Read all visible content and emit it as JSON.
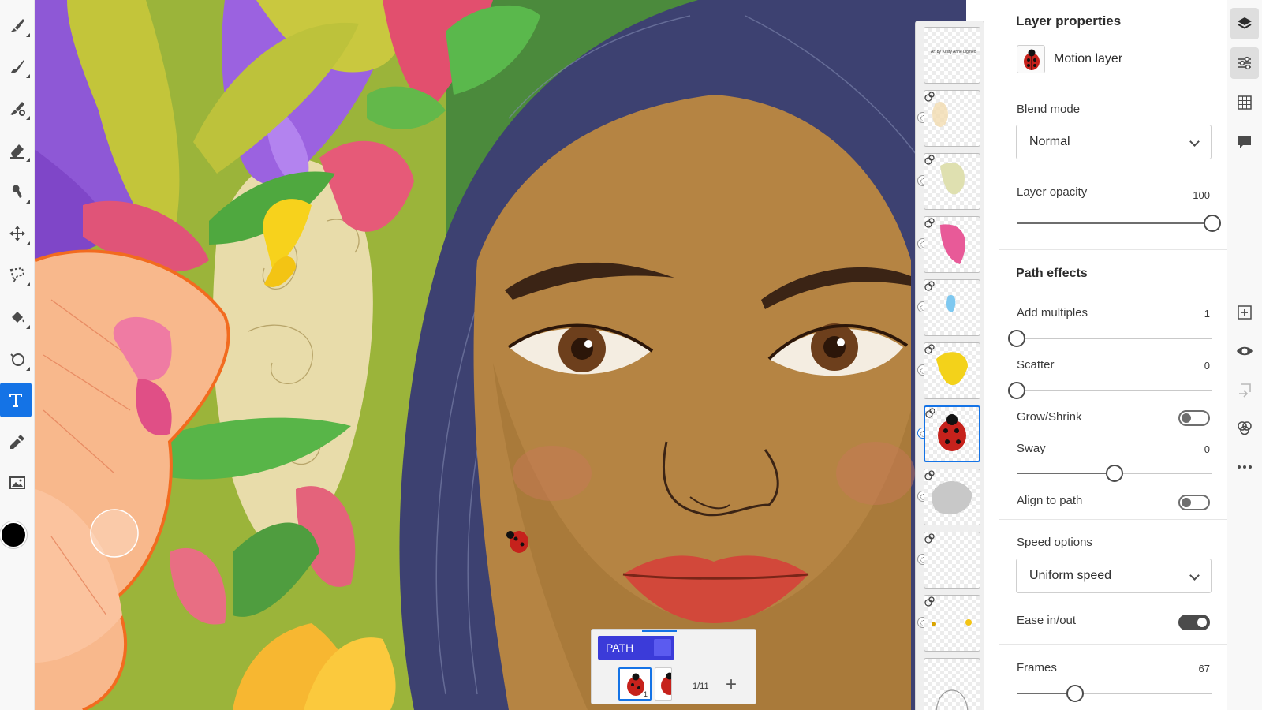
{
  "toolbar": {
    "tools": [
      {
        "name": "pixel-brush-tool",
        "icon": "pixel-brush-icon"
      },
      {
        "name": "live-brush-tool",
        "icon": "live-brush-icon"
      },
      {
        "name": "vector-brush-tool",
        "icon": "vector-brush-icon"
      },
      {
        "name": "eraser-tool",
        "icon": "eraser-icon"
      },
      {
        "name": "smudge-tool",
        "icon": "smudge-icon"
      },
      {
        "name": "transform-tool",
        "icon": "move-icon"
      },
      {
        "name": "selection-tool",
        "icon": "lasso-icon"
      },
      {
        "name": "fill-tool",
        "icon": "paint-bucket-icon"
      },
      {
        "name": "shapes-tool",
        "icon": "shapes-icon"
      },
      {
        "name": "text-tool",
        "icon": "text-icon",
        "active": true
      },
      {
        "name": "eyedropper-tool",
        "icon": "eyedropper-icon"
      },
      {
        "name": "image-tool",
        "icon": "image-icon"
      }
    ],
    "current_color": "#000000"
  },
  "canvas": {
    "artwork_credit": "Art by Kirsty Anne Ligmeo"
  },
  "path_popup": {
    "tab_label": "PATH",
    "frame_number": "1",
    "frame_count": "1/11",
    "add_label": "+"
  },
  "properties": {
    "title": "Layer properties",
    "layer_name": "Motion layer",
    "blend_mode": {
      "label": "Blend mode",
      "value": "Normal"
    },
    "opacity": {
      "label": "Layer opacity",
      "value": "100",
      "fraction": 1.0
    },
    "path_effects": {
      "title": "Path effects",
      "add_multiples": {
        "label": "Add multiples",
        "value": "1",
        "fraction": 0.0
      },
      "scatter": {
        "label": "Scatter",
        "value": "0",
        "fraction": 0.0
      },
      "grow_shrink": {
        "label": "Grow/Shrink",
        "enabled": false
      },
      "sway": {
        "label": "Sway",
        "value": "0",
        "fraction": 0.5
      },
      "align_to_path": {
        "label": "Align to path",
        "enabled": false
      },
      "speed_options": {
        "label": "Speed options",
        "value": "Uniform speed"
      },
      "ease_in_out": {
        "label": "Ease in/out",
        "enabled": true
      },
      "frames": {
        "label": "Frames",
        "value": "67",
        "fraction": 0.3
      }
    }
  },
  "rail": {
    "items": [
      "layers-icon",
      "adjustments-icon",
      "grid-icon",
      "comments-icon",
      "add-layer-icon",
      "visibility-icon",
      "merge-icon",
      "blend-icon",
      "more-icon"
    ],
    "accent": "#1473e6"
  }
}
